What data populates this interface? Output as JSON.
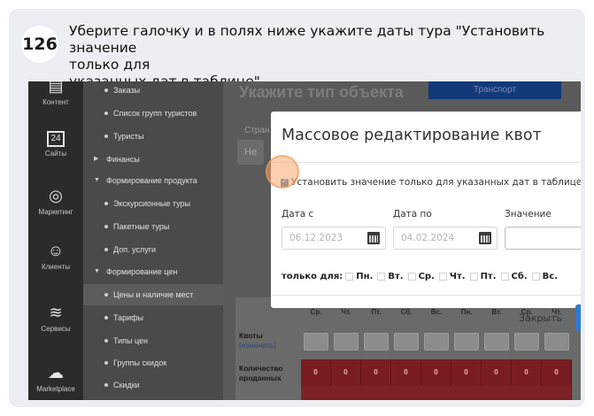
{
  "step": {
    "number": "126",
    "text": "Уберите галочку и в полях ниже укажите даты тура \"Установить значение только для указанных дат в таблице\"",
    "text_line1": "Уберите галочку и в полях ниже укажите даты тура \"Установить значение",
    "text_line2": "только для",
    "text_line3": "указанных дат в таблице\""
  },
  "rail": {
    "items": [
      {
        "label": "Контент",
        "icon": "document-icon"
      },
      {
        "label": "Сайты",
        "icon": "calendar-24-icon"
      },
      {
        "label": "Маркетинг",
        "icon": "target-icon"
      },
      {
        "label": "Клиенты",
        "icon": "clients-icon"
      },
      {
        "label": "Сервисы",
        "icon": "layers-icon"
      },
      {
        "label": "Marketplace",
        "icon": "cloud-upload-icon"
      }
    ]
  },
  "menu": {
    "items": [
      {
        "label": "Заказы",
        "kind": "sub"
      },
      {
        "label": "Список групп туристов",
        "kind": "sub"
      },
      {
        "label": "Туристы",
        "kind": "sub"
      },
      {
        "label": "Финансы",
        "kind": "top-collapsed"
      },
      {
        "label": "Формирование продукта",
        "kind": "top-expanded"
      },
      {
        "label": "Экскурсионные туры",
        "kind": "sub"
      },
      {
        "label": "Пакетные туры",
        "kind": "sub"
      },
      {
        "label": "Доп. услуги",
        "kind": "sub"
      },
      {
        "label": "Формирование цен",
        "kind": "top-expanded"
      },
      {
        "label": "Цены и наличие мест",
        "kind": "sub-active"
      },
      {
        "label": "Тарифы",
        "kind": "sub"
      },
      {
        "label": "Типы цен",
        "kind": "sub"
      },
      {
        "label": "Группы скидок",
        "kind": "sub"
      },
      {
        "label": "Скидки",
        "kind": "sub"
      }
    ]
  },
  "main": {
    "title": "Укажите тип объекта",
    "transport_button": "Транспорт",
    "side_label": "Стран",
    "side_button": "Не"
  },
  "table": {
    "day_headers": [
      "Ср.",
      "Чт.",
      "Пт.",
      "Сб.",
      "Вс.",
      "Пн.",
      "Вт.",
      "Ср.",
      "Чт."
    ],
    "quotas_label": "Квоты",
    "quotas_link": "[изменить]",
    "sold_label_line1": "Количество",
    "sold_label_line2": "проданных",
    "sold_values": [
      "0",
      "0",
      "0",
      "0",
      "0",
      "0",
      "0",
      "0",
      "0"
    ]
  },
  "modal": {
    "title": "Массовое редактирование квот",
    "checkbox_label": "Установить значение только для указанных дат в таблице",
    "checkbox_checked": true,
    "date_from_label": "Дата с",
    "date_from_value": "06.12.2023",
    "date_to_label": "Дата по",
    "date_to_value": "04.02.2024",
    "value_label": "Значение",
    "value_input": "",
    "days_prefix": "только для:",
    "days": [
      "Пн.",
      "Вт.",
      "Ср.",
      "Чт.",
      "Пт.",
      "Сб.",
      "Вс."
    ],
    "close_button": "Закрыть"
  },
  "colors": {
    "accent_blue": "#2f7ad0",
    "highlight": "#f5aa6e",
    "table_red": "#7a1d22"
  }
}
